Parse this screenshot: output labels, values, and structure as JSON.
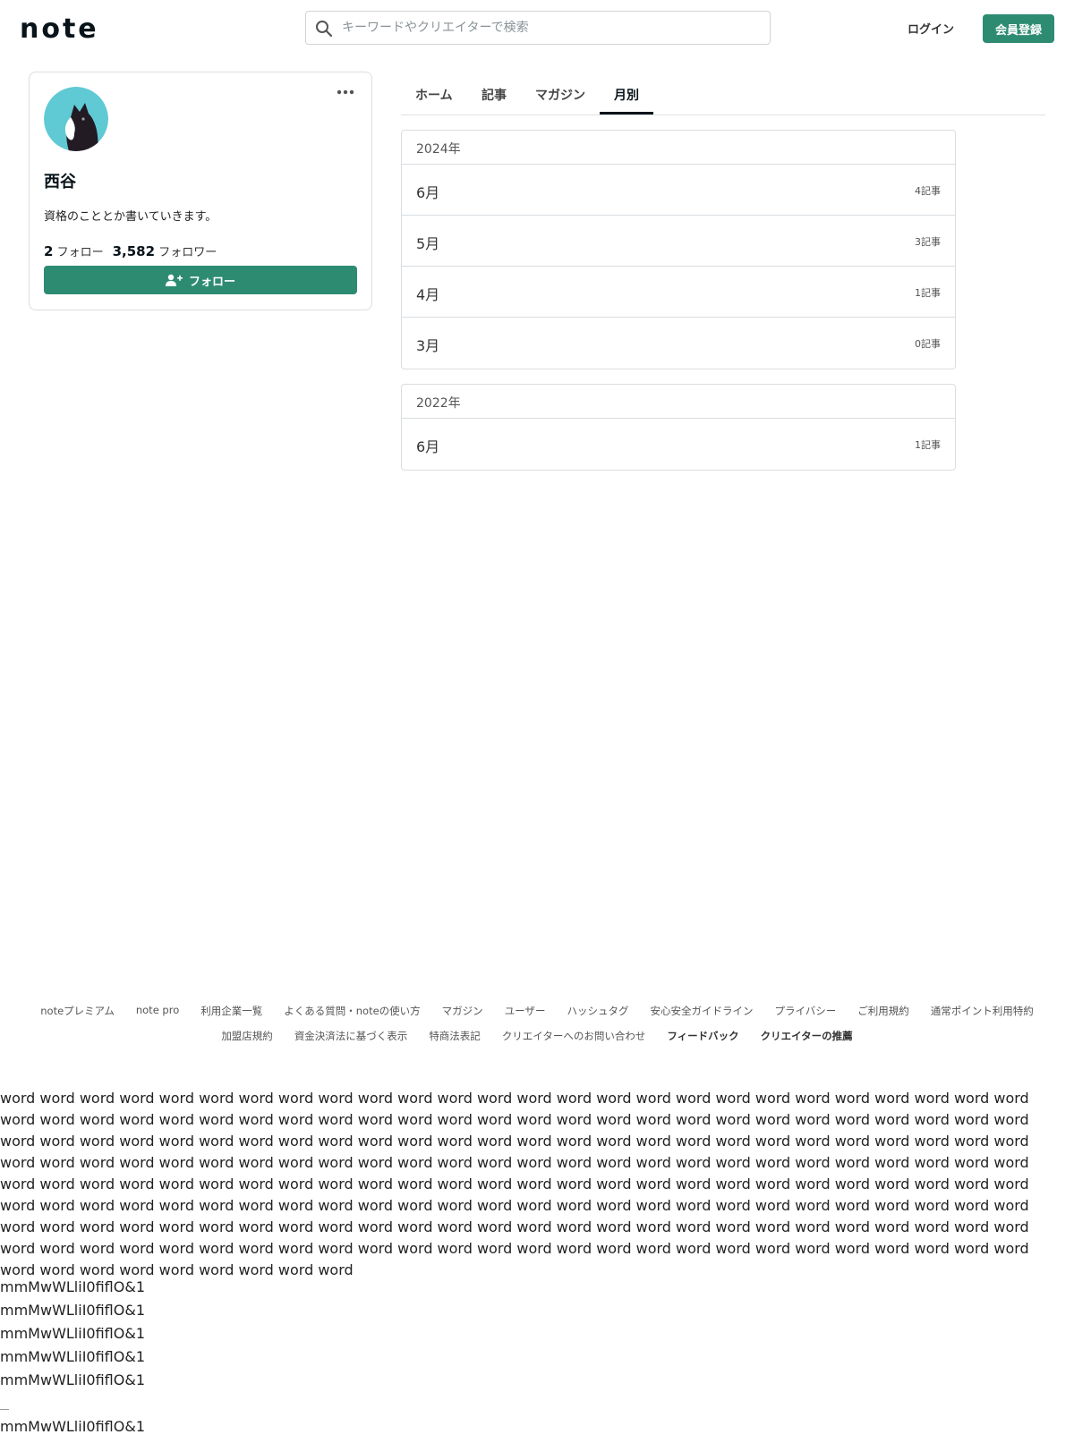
{
  "header": {
    "logo_text": "note",
    "search_placeholder": "キーワードやクリエイターで検索",
    "login_label": "ログイン",
    "signup_label": "会員登録"
  },
  "profile": {
    "name": "西谷",
    "bio": "資格のこととか書いていきます。",
    "follow_count": "2",
    "follow_label": "フォロー",
    "follower_count": "3,582",
    "follower_label": "フォロワー",
    "follow_button_label": "フォロー"
  },
  "tabs": [
    {
      "label": "ホーム"
    },
    {
      "label": "記事"
    },
    {
      "label": "マガジン"
    },
    {
      "label": "月別",
      "active": true
    }
  ],
  "archive": [
    {
      "year": "2024年",
      "months": [
        {
          "month": "6月",
          "count": "4記事"
        },
        {
          "month": "5月",
          "count": "3記事"
        },
        {
          "month": "4月",
          "count": "1記事"
        },
        {
          "month": "3月",
          "count": "0記事"
        }
      ]
    },
    {
      "year": "2022年",
      "months": [
        {
          "month": "6月",
          "count": "1記事"
        }
      ]
    }
  ],
  "footer": {
    "row1": [
      "noteプレミアム",
      "note pro",
      "利用企業一覧",
      "よくある質問・noteの使い方",
      "マガジン",
      "ユーザー",
      "ハッシュタグ",
      "安心安全ガイドライン",
      "プライバシー",
      "ご利用規約",
      "通常ポイント利用特約"
    ],
    "row2": [
      "加盟店規約",
      "資金決済法に基づく表示",
      "特商法表記",
      "クリエイターへのお問い合わせ",
      "フィードバック",
      "クリエイターの推薦"
    ]
  },
  "filler": {
    "word_paragraph": "word word word word word word word word word word word word word word word word word word word word word word word word word word word word word word word word word word word word word word word word word word word word word word word word word word word word word word word word word word word word word word word word word word word word word word word word word word word word word word word word word word word word word word word word word word word word word word word word word word word word word word word word word word word word word word word word word word word word word word word word word word word word word word word word word word word word word word word word word word word word word word word word word word word word word word word word word word word word word word word word word word word word word word word word word word word word word word word word word word word word word word word word word word word word word word word word word word word word word word word word word word word word word word word word word word word word word word word word word",
    "glyph_line": "mmMwWLliI0fiflO&1"
  },
  "colors": {
    "brand": "#2d8b72",
    "avatar_bg": "#5fc9d4"
  }
}
